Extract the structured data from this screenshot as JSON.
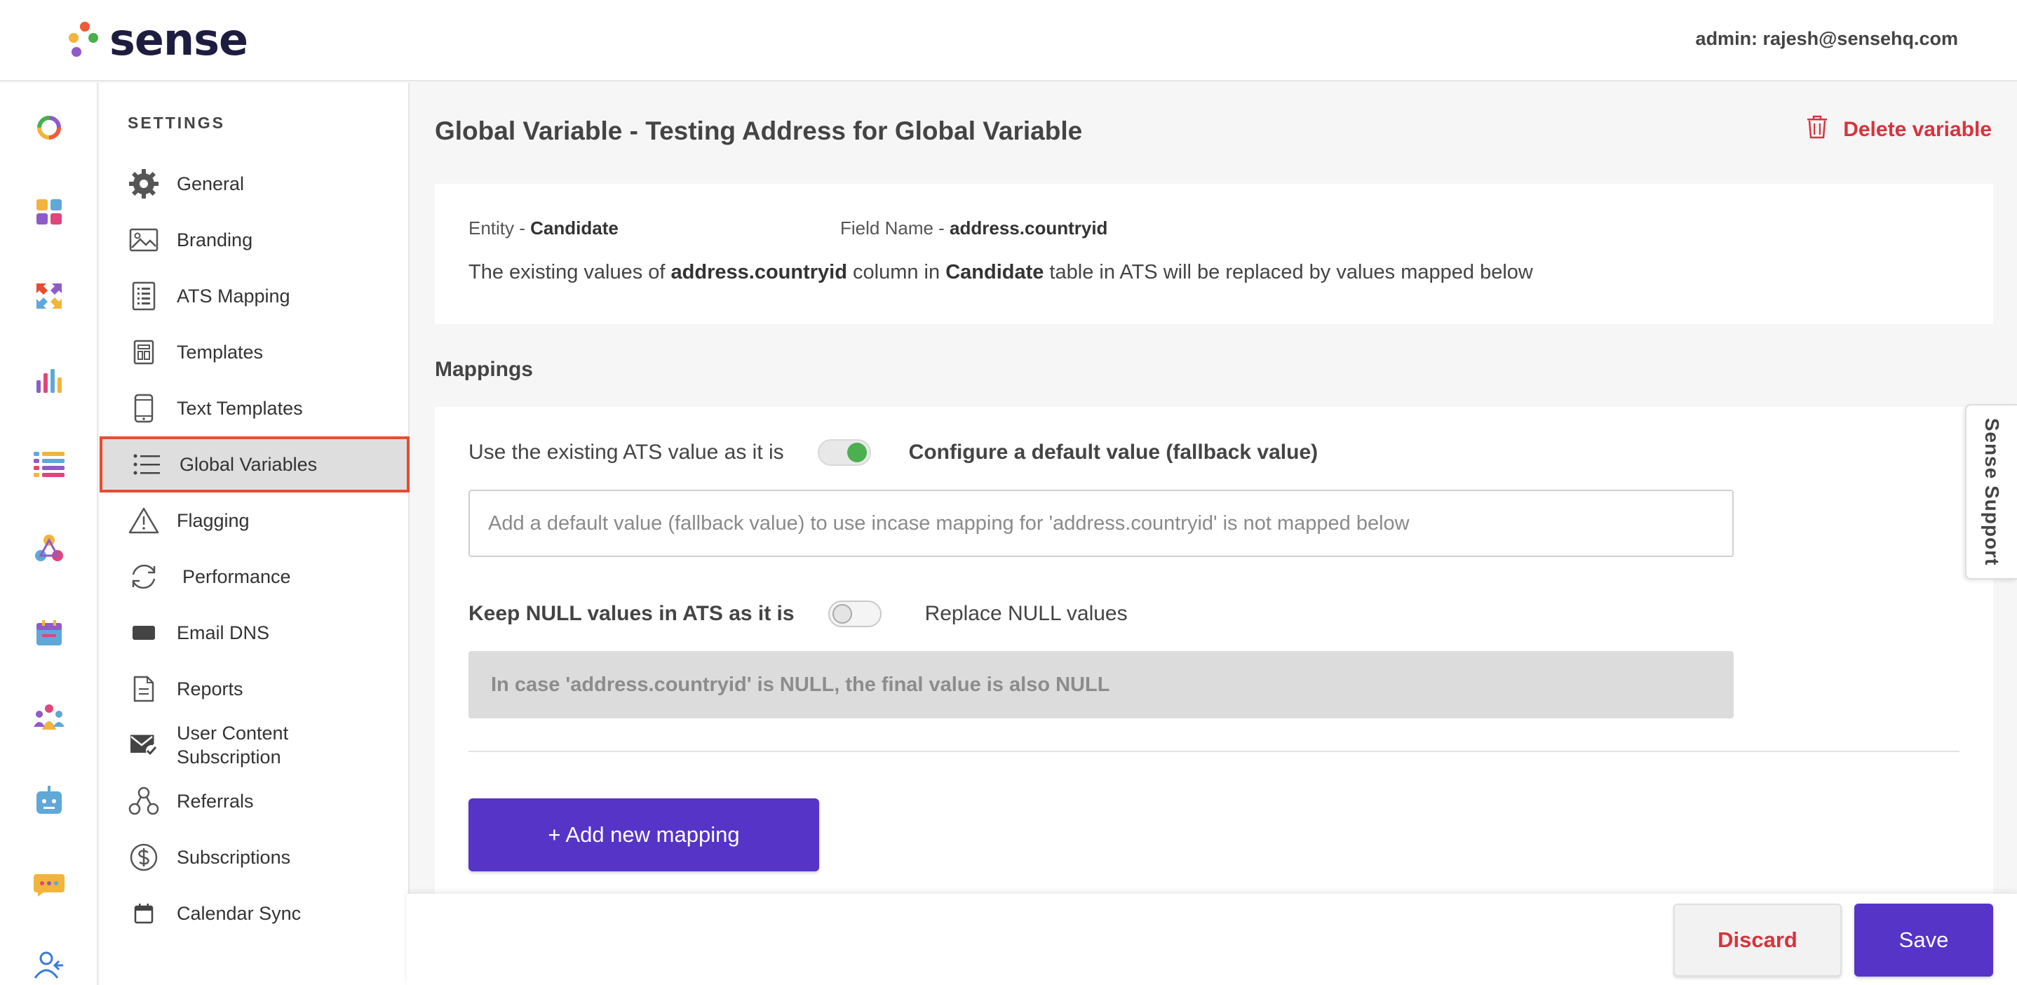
{
  "brand": {
    "name": "sense"
  },
  "header": {
    "user": "admin: rajesh@sensehq.com"
  },
  "rail": {
    "icons": [
      "ring-logo-icon",
      "dashboard-icon",
      "arrows-icon",
      "analytics-icon",
      "lists-icon",
      "network-icon",
      "calendar-icon",
      "team-icon",
      "chatbot-icon",
      "messages-icon",
      "user-referral-icon"
    ]
  },
  "sidebar": {
    "title": "SETTINGS",
    "items": [
      {
        "label": "General",
        "icon": "gear-icon"
      },
      {
        "label": "Branding",
        "icon": "image-icon"
      },
      {
        "label": "ATS Mapping",
        "icon": "document-list-icon"
      },
      {
        "label": "Templates",
        "icon": "template-icon"
      },
      {
        "label": "Text Templates",
        "icon": "phone-icon"
      },
      {
        "label": "Global Variables",
        "icon": "list-icon",
        "active": true
      },
      {
        "label": "Flagging",
        "icon": "warning-icon"
      },
      {
        "label": "Performance",
        "icon": "refresh-icon"
      },
      {
        "label": "Email DNS",
        "icon": "email-dns-icon"
      },
      {
        "label": "Reports",
        "icon": "report-icon"
      },
      {
        "label": "User Content\nSubscription",
        "icon": "mail-check-icon"
      },
      {
        "label": "Referrals",
        "icon": "referral-icon"
      },
      {
        "label": "Subscriptions",
        "icon": "dollar-icon"
      },
      {
        "label": "Calendar Sync",
        "icon": "calendar-icon"
      }
    ]
  },
  "page": {
    "title": "Global Variable - Testing Address for Global Variable",
    "delete_label": "Delete variable"
  },
  "info": {
    "entity_label": "Entity - ",
    "entity_value": "Candidate",
    "field_label": "Field Name - ",
    "field_value": "address.countryid",
    "desc_prefix": "The existing values of ",
    "desc_field": "address.countryid",
    "desc_mid": " column in ",
    "desc_entity": "Candidate",
    "desc_suffix": " table in ATS will be replaced by values mapped below"
  },
  "mappings": {
    "heading": "Mappings",
    "use_existing_label": "Use the existing ATS value as it is",
    "configure_default_label": "Configure a default value (fallback value)",
    "default_toggle_on": true,
    "default_placeholder": "Add a default value (fallback value) to use incase mapping for 'address.countryid' is not mapped below",
    "keep_null_label": "Keep NULL values in ATS as it is",
    "replace_null_label": "Replace NULL values",
    "null_toggle_on": false,
    "null_info": "In case 'address.countryid' is NULL, the final value is also NULL",
    "add_button": "+ Add new mapping"
  },
  "support": {
    "label": "Sense Support"
  },
  "footer": {
    "discard": "Discard",
    "save": "Save"
  },
  "colors": {
    "primary": "#5634c8",
    "danger": "#d8333d",
    "toggle_on": "#4caf50",
    "active_border": "#e84b2e"
  }
}
